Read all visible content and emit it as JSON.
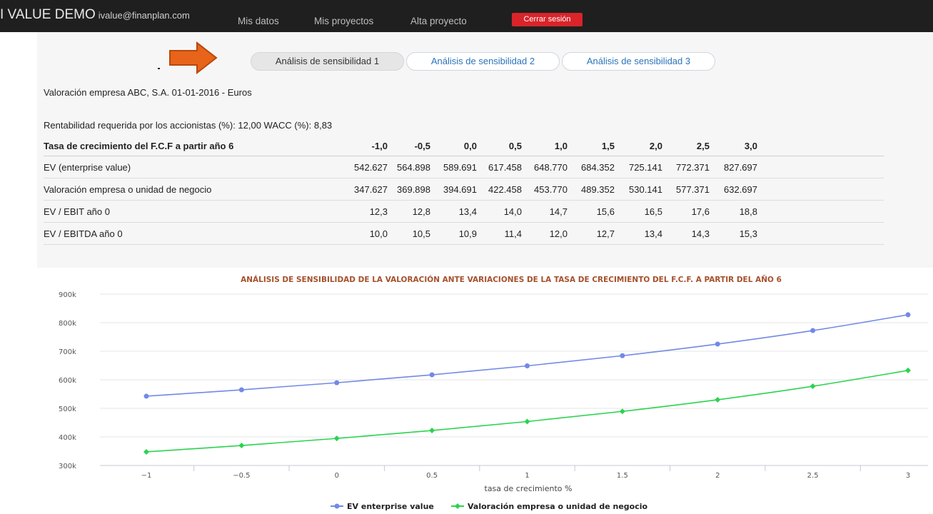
{
  "header": {
    "brand": "I VALUE DEMO",
    "email": "ivalue@finanplan.com",
    "nav": [
      "Mis datos",
      "Mis proyectos",
      "Alta proyecto"
    ],
    "logout": "Cerrar sesión"
  },
  "tabs": [
    "Análisis de sensibilidad 1",
    "Análisis de sensibilidad 2",
    "Análisis de sensibilidad 3"
  ],
  "active_tab": 0,
  "heading": "Valoración empresa ABC, S.A. 01-01-2016 - Euros",
  "rates": "Rentabilidad requerida por los accionistas (%): 12,00   WACC (%): 8,83",
  "table": {
    "header_label": "Tasa de crecimiento del F.C.F a partir año 6",
    "columns": [
      "-1,0",
      "-0,5",
      "0,0",
      "0,5",
      "1,0",
      "1,5",
      "2,0",
      "2,5",
      "3,0"
    ],
    "rows": [
      {
        "label": "EV (enterprise value)",
        "values": [
          "542.627",
          "564.898",
          "589.691",
          "617.458",
          "648.770",
          "684.352",
          "725.141",
          "772.371",
          "827.697"
        ]
      },
      {
        "label": "Valoración empresa o unidad de negocio",
        "values": [
          "347.627",
          "369.898",
          "394.691",
          "422.458",
          "453.770",
          "489.352",
          "530.141",
          "577.371",
          "632.697"
        ]
      },
      {
        "label": "EV / EBIT año 0",
        "values": [
          "12,3",
          "12,8",
          "13,4",
          "14,0",
          "14,7",
          "15,6",
          "16,5",
          "17,6",
          "18,8"
        ]
      },
      {
        "label": "EV / EBITDA año 0",
        "values": [
          "10,0",
          "10,5",
          "10,9",
          "11,4",
          "12,0",
          "12,7",
          "13,4",
          "14,3",
          "15,3"
        ]
      }
    ]
  },
  "chart_data": {
    "type": "line",
    "title": "ANÁLISIS DE SENSIBILIDAD DE LA VALORACIÓN ANTE VARIACIONES DE LA TASA DE CRECIMIENTO DEL F.C.F. A PARTIR DEL AÑO 6",
    "xlabel": "tasa de crecimiento %",
    "ylabel": "",
    "x": [
      -1,
      -0.5,
      0,
      0.5,
      1,
      1.5,
      2,
      2.5,
      3
    ],
    "x_tick_labels": [
      "−1",
      "−0.5",
      "0",
      "0.5",
      "1",
      "1.5",
      "2",
      "2.5",
      "3"
    ],
    "ylim": [
      300000,
      900000
    ],
    "y_ticks": [
      300000,
      400000,
      500000,
      600000,
      700000,
      800000,
      900000
    ],
    "y_tick_labels": [
      "300k",
      "400k",
      "500k",
      "600k",
      "700k",
      "800k",
      "900k"
    ],
    "grid": true,
    "legend_position": "bottom",
    "series": [
      {
        "name": "EV enterprise value",
        "color": "#7289e6",
        "values": [
          542627,
          564898,
          589691,
          617458,
          648770,
          684352,
          725141,
          772371,
          827697
        ]
      },
      {
        "name": "Valoración empresa o unidad de negocio",
        "color": "#2bd34f",
        "values": [
          347627,
          369898,
          394691,
          422458,
          453770,
          489352,
          530141,
          577371,
          632697
        ]
      }
    ]
  },
  "colors": {
    "topbar": "#1f1f1f",
    "logout": "#d9242a",
    "link": "#2a74bb",
    "arrow": "#e8641a",
    "chart_title": "#a5502c"
  }
}
